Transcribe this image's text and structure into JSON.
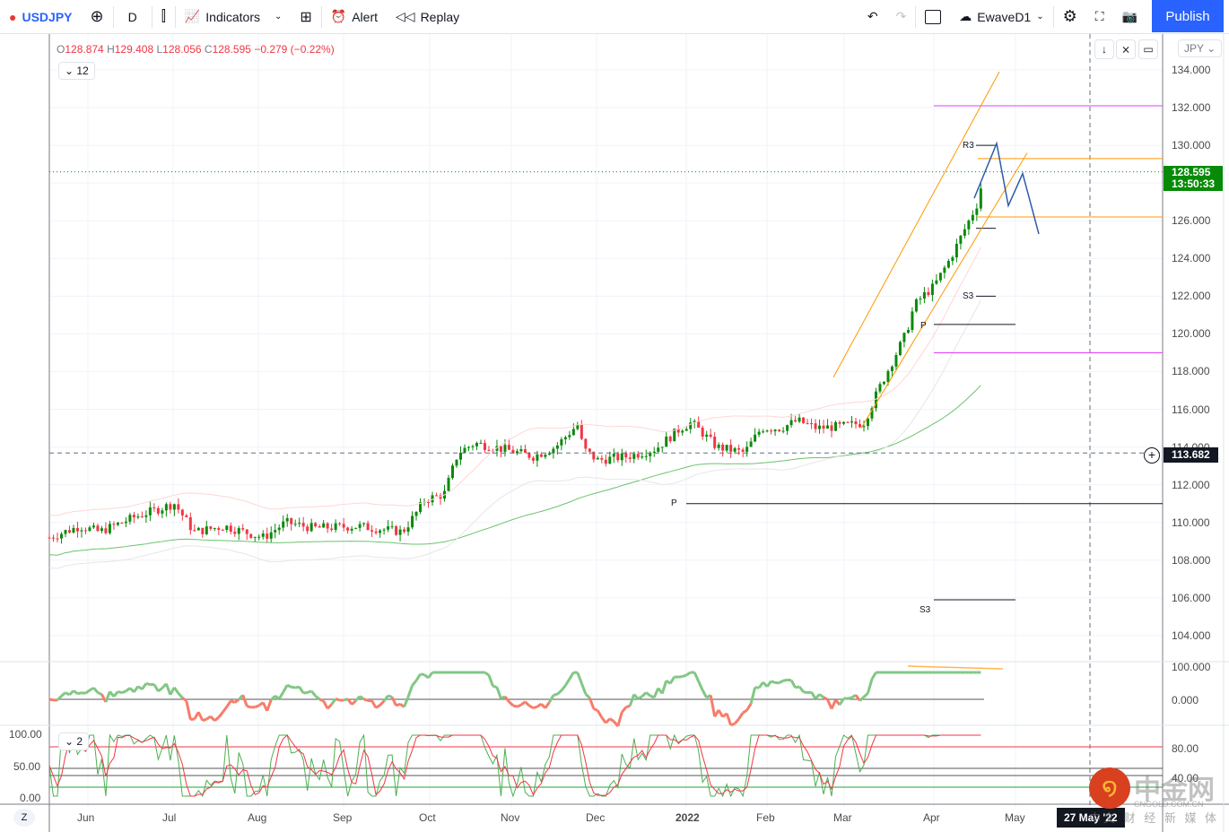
{
  "toolbar": {
    "symbol": "USDJPY",
    "interval": "D",
    "indicators": "Indicators",
    "alert": "Alert",
    "replay": "Replay",
    "layout_name": "EwaveD1",
    "publish": "Publish"
  },
  "legend": {
    "o_label": "O",
    "o": "128.874",
    "h_label": "H",
    "h": "129.408",
    "l_label": "L",
    "l": "128.056",
    "c_label": "C",
    "c": "128.595",
    "change": "−0.279 (−0.22%)",
    "indicator_count": "12"
  },
  "pane2": {
    "indicator_count": "2"
  },
  "price_axis": {
    "currency": "JPY",
    "ticks": [
      "134.000",
      "132.000",
      "130.000",
      "128.000",
      "126.000",
      "124.000",
      "122.000",
      "120.000",
      "118.000",
      "116.000",
      "114.000",
      "112.000",
      "110.000",
      "108.000",
      "106.000",
      "104.000"
    ],
    "last_price": "128.595",
    "countdown": "13:50:33",
    "crosshair_price": "113.682"
  },
  "osc_axis": {
    "ticks": [
      "100.000",
      "0.000"
    ]
  },
  "stoch_axis": {
    "ticks_right": [
      "80.00",
      "40.00"
    ],
    "ticks_left": [
      "100.00",
      "50.00",
      "0.00"
    ]
  },
  "time_axis": {
    "labels": [
      "Jun",
      "Jul",
      "Aug",
      "Sep",
      "Oct",
      "Nov",
      "Dec",
      "2022",
      "Feb",
      "Mar",
      "Apr",
      "May"
    ],
    "crosshair_date": "27 May '22",
    "z_button": "Z"
  },
  "annotations": {
    "r3": "R3",
    "s3_upper": "S3",
    "p_upper": "P",
    "p_lower": "P",
    "s3_lower": "S3"
  },
  "watermark": {
    "brand": "中金网",
    "url": "CNGOLD.COM.CN",
    "slogan": "中文 财 经 新 媒 体"
  },
  "colors": {
    "up": "#089981",
    "up_fill": "#0b8a0b",
    "down": "#f23645",
    "accent": "#2962ff",
    "channel": "#ff9800",
    "pivot_magenta": "#e040fb"
  },
  "chart_data": {
    "type": "candlestick",
    "symbol": "USDJPY",
    "timeframe": "D",
    "ylim": [
      104,
      134
    ],
    "close_path": [
      [
        0,
        109.2
      ],
      [
        11,
        109.8
      ],
      [
        18,
        109.5
      ],
      [
        31,
        110.3
      ],
      [
        45,
        111.0
      ],
      [
        52,
        109.5
      ],
      [
        63,
        109.8
      ],
      [
        77,
        109.2
      ],
      [
        85,
        110.0
      ],
      [
        95,
        109.7
      ],
      [
        111,
        109.8
      ],
      [
        127,
        109.5
      ],
      [
        131,
        110.3
      ],
      [
        135,
        111.2
      ],
      [
        142,
        111.5
      ],
      [
        147,
        113.7
      ],
      [
        153,
        114.2
      ],
      [
        163,
        113.9
      ],
      [
        174,
        113.5
      ],
      [
        182,
        114.0
      ],
      [
        190,
        115.2
      ],
      [
        192,
        113.9
      ],
      [
        197,
        113.3
      ],
      [
        208,
        113.5
      ],
      [
        218,
        113.9
      ],
      [
        227,
        115.0
      ],
      [
        231,
        115.3
      ],
      [
        240,
        114.0
      ],
      [
        250,
        113.7
      ],
      [
        256,
        115.0
      ],
      [
        263,
        115.0
      ],
      [
        269,
        115.4
      ],
      [
        276,
        115.0
      ],
      [
        285,
        115.1
      ],
      [
        293,
        115.3
      ],
      [
        298,
        117.0
      ],
      [
        303,
        118.5
      ],
      [
        308,
        120.0
      ],
      [
        311,
        121.5
      ],
      [
        314,
        122.0
      ],
      [
        318,
        122.5
      ],
      [
        324,
        124.0
      ],
      [
        329,
        125.5
      ],
      [
        334,
        127.0
      ],
      [
        336,
        128.6
      ]
    ]
  }
}
